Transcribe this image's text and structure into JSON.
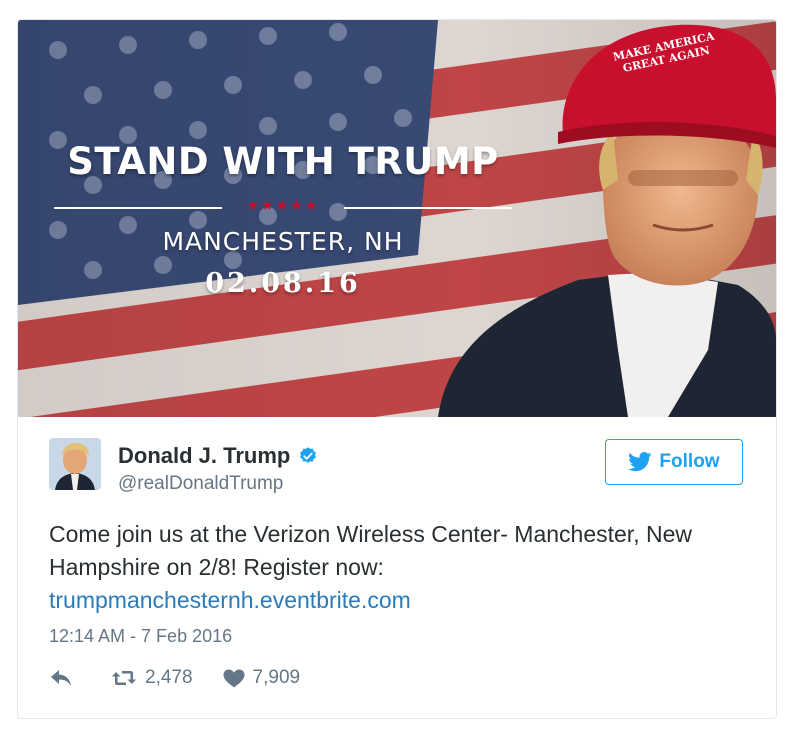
{
  "banner": {
    "title": "STAND WITH TRUMP",
    "stars": "★★★★★",
    "city": "MANCHESTER, NH",
    "date": "02.08.16",
    "hat_line1": "MAKE AMERICA",
    "hat_line2": "GREAT AGAIN"
  },
  "tweet": {
    "name": "Donald J. Trump",
    "handle": "@realDonaldTrump",
    "verified_icon": "verified-badge-icon",
    "follow_label": "Follow",
    "text": "Come join us at the Verizon Wireless Center- Manchester, New Hampshire on 2/8! Register now:",
    "link": "trumpmanchesternh.eventbrite.com",
    "timestamp": "12:14 AM - 7 Feb 2016",
    "retweets": "2,478",
    "likes": "7,909"
  },
  "colors": {
    "accent": "#1da1f2",
    "link": "#2b7bb9",
    "muted": "#657786",
    "hat_red": "#c8102e"
  }
}
